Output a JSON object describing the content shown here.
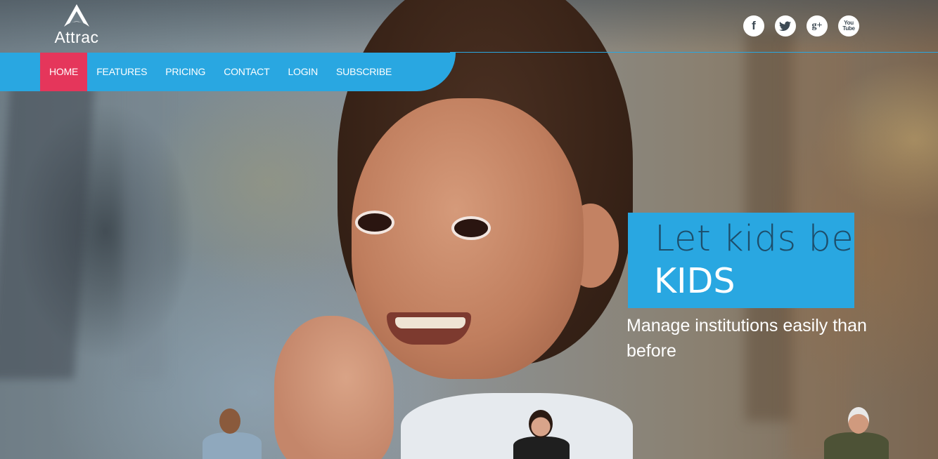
{
  "brand": {
    "name": "Attrac"
  },
  "social": [
    {
      "label": "f",
      "icon": "facebook-icon"
    },
    {
      "label": "t",
      "icon": "twitter-icon"
    },
    {
      "label": "g+",
      "icon": "google-plus-icon"
    },
    {
      "label_top": "You",
      "label_bottom": "Tube",
      "icon": "youtube-icon"
    }
  ],
  "nav": {
    "items": [
      {
        "label": "HOME",
        "active": true
      },
      {
        "label": "FEATURES",
        "active": false
      },
      {
        "label": "PRICING",
        "active": false
      },
      {
        "label": "CONTACT",
        "active": false
      },
      {
        "label": "LOGIN",
        "active": false
      },
      {
        "label": "SUBSCRIBE",
        "active": false
      }
    ]
  },
  "hero": {
    "tagline_light": "Let kids be",
    "tagline_bold": "KIDS",
    "subtitle": "Manage institutions easily than before"
  },
  "colors": {
    "accent": "#29a7e1",
    "active_nav": "#e5365b",
    "tagline_dark": "#1d4e6b",
    "text": "#ffffff"
  }
}
